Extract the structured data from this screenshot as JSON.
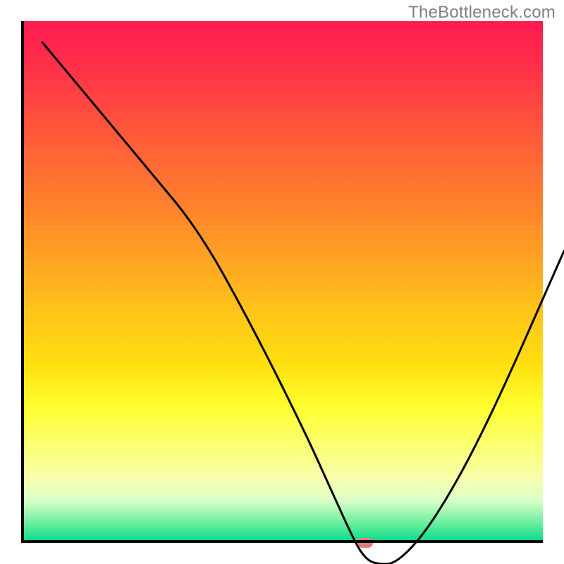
{
  "watermark": "TheBottleneck.com",
  "chart_data": {
    "type": "line",
    "title": "",
    "xlabel": "",
    "ylabel": "",
    "xlim": [
      0,
      100
    ],
    "ylim": [
      0,
      100
    ],
    "grid": false,
    "x": [
      0,
      10,
      20,
      30,
      40,
      50,
      55,
      60,
      62,
      64,
      68,
      75,
      85,
      100
    ],
    "values": [
      100,
      88,
      76,
      64,
      46,
      26,
      15,
      4,
      1,
      0,
      0,
      8,
      26,
      60
    ],
    "color": "#000000",
    "background_gradient_top": "#ff1a50",
    "background_gradient_bottom": "#00da88",
    "marker": {
      "x": 66,
      "y": 0,
      "color": "#e47a78"
    }
  }
}
